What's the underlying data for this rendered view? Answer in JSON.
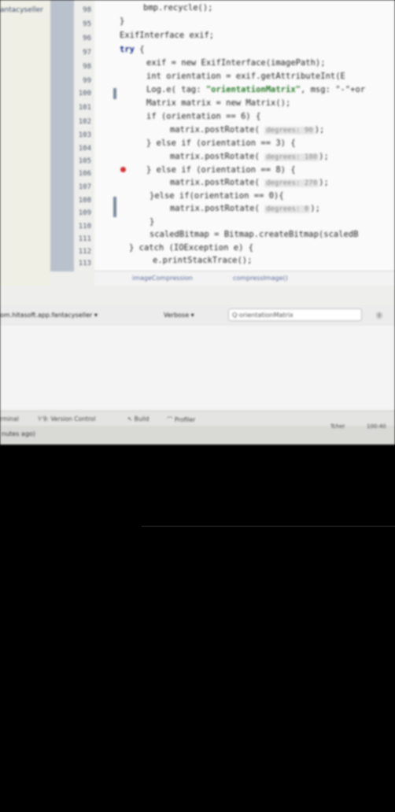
{
  "project_panel": {
    "title": "antacyseller"
  },
  "editor": {
    "line_numbers": [
      "98",
      "95",
      "96",
      "97",
      "98",
      "99",
      "100",
      "101",
      "102",
      "103",
      "104",
      "105",
      "106",
      "107",
      "108",
      "109",
      "110",
      "111",
      "112",
      "113"
    ],
    "code": {
      "l1": "bmp.recycle();",
      "l2": "}",
      "l3": "ExifInterface exif;",
      "l4_kw": "try",
      "l4_rest": " {",
      "l5": "exif = new ExifInterface(imagePath);",
      "l6": "int orientation = exif.getAttributeInt(E",
      "l7_a": "Log.e( tag: ",
      "l7_str": "\"orientationMatrix\"",
      "l7_b": ", msg: \"-\"+or",
      "l8": "Matrix matrix = new Matrix();",
      "l9": "if (orientation == 6) {",
      "l10_a": "matrix.postRotate( ",
      "l10_hint": "degrees: 90",
      "l10_b": ");",
      "l11": "} else if (orientation == 3) {",
      "l12_a": "matrix.postRotate( ",
      "l12_hint": "degrees: 180",
      "l12_b": ");",
      "l13": "} else if (orientation == 8) {",
      "l14_a": "matrix.postRotate( ",
      "l14_hint": "degrees: 270",
      "l14_b": ");",
      "l15": "}else if(orientation == 0){",
      "l16_a": "matrix.postRotate( ",
      "l16_hint": "degrees: 0",
      "l16_b": ");",
      "l17": "}",
      "l18": "scaledBitmap = Bitmap.createBitmap(scaledB",
      "l19": "} catch (IOException e) {",
      "l20": "e.printStackTrace();"
    },
    "breadcrumb": [
      "imageCompression",
      "compressImage()"
    ]
  },
  "logcat": {
    "process": "om.hitasoft.app.fantacyseller",
    "level": "Verbose",
    "search": "orientationMatrix"
  },
  "tool_windows": [
    "rminal",
    "9: Version Control",
    "Build",
    "Profiler"
  ],
  "status": {
    "text": "nutes ago)",
    "right_1": "Tcher",
    "right_2": "100:40"
  }
}
